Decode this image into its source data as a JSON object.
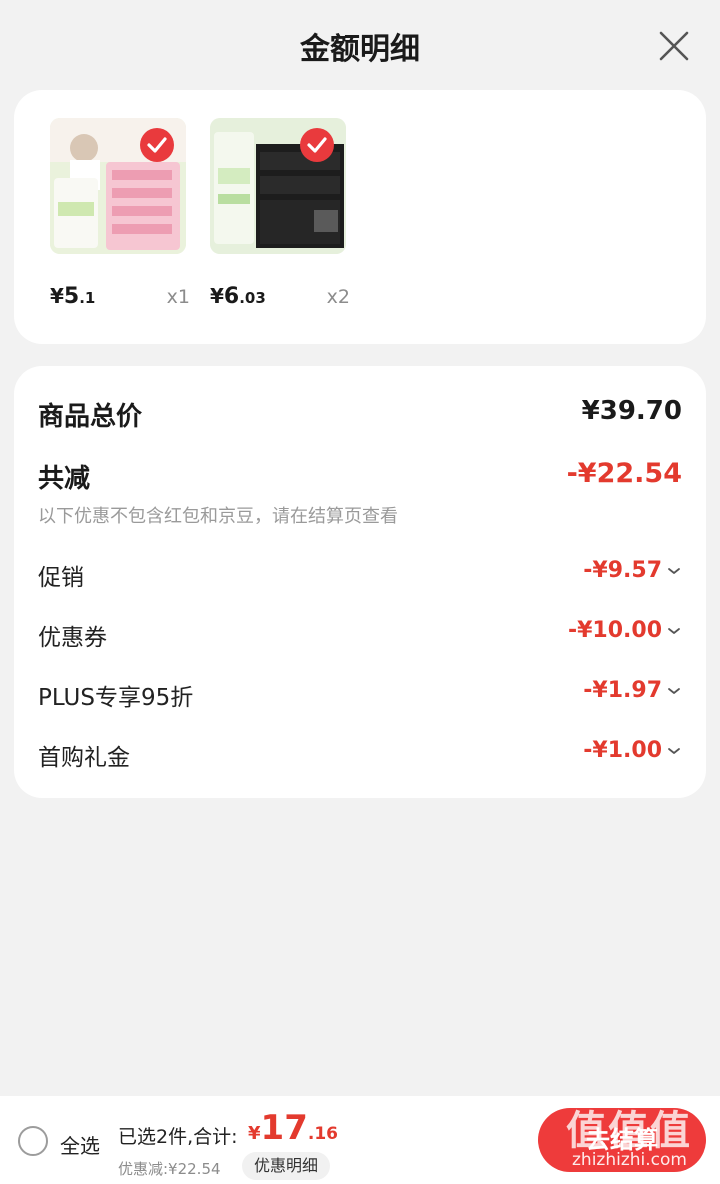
{
  "header": {
    "title": "金额明细"
  },
  "products": [
    {
      "price_symbol": "¥",
      "price_int": "5",
      "price_dec": ".1",
      "qty": "x1"
    },
    {
      "price_symbol": "¥",
      "price_int": "6",
      "price_dec": ".03",
      "qty": "x2"
    }
  ],
  "summary": {
    "total_label": "商品总价",
    "total_value": "¥39.70",
    "reduce_label": "共减",
    "reduce_value": "-¥22.54",
    "hint": "以下优惠不包含红包和京豆，请在结算页查看",
    "discounts": [
      {
        "label": "促销",
        "value": "-¥9.57"
      },
      {
        "label": "优惠券",
        "value": "-¥10.00"
      },
      {
        "label": "PLUS专享95折",
        "value": "-¥1.97"
      },
      {
        "label": "首购礼金",
        "value": "-¥1.00"
      }
    ]
  },
  "bottom": {
    "select_all": "全选",
    "selected_text": "已选2件,合计:",
    "total_symbol": "¥",
    "total_int": "17",
    "total_dec": ".16",
    "discount_text": "优惠减:¥22.54",
    "detail_button": "优惠明细",
    "checkout": "去结算"
  },
  "watermark": {
    "big": "值值值",
    "small": "zhizhizhi.com"
  },
  "colors": {
    "accent_red": "#e33a2e",
    "button_red": "#ee3b3b",
    "background": "#f2f2f2"
  }
}
